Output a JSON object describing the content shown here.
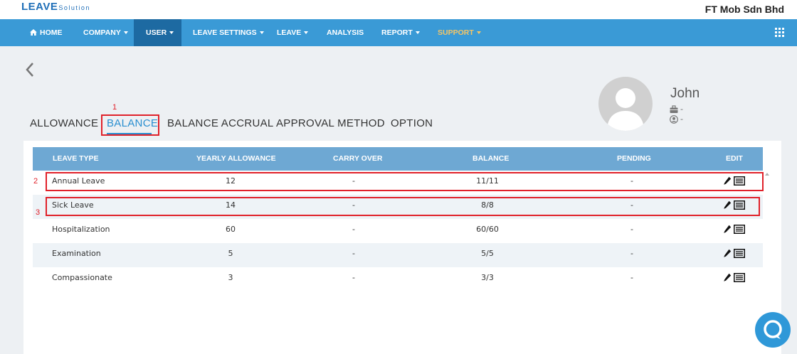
{
  "brand": {
    "logo_main": "LEAVE",
    "logo_sub": "Solution",
    "company": "FT Mob Sdn Bhd",
    "accent": "#3a9ad6"
  },
  "nav": {
    "items": [
      {
        "label": "HOME",
        "icon": "home-icon",
        "dropdown": false
      },
      {
        "label": "COMPANY",
        "dropdown": true
      },
      {
        "label": "USER",
        "dropdown": true,
        "active": true
      },
      {
        "label": "LEAVE SETTINGS",
        "dropdown": true
      },
      {
        "label": "LEAVE",
        "dropdown": true
      },
      {
        "label": "ANALYSIS",
        "dropdown": false
      },
      {
        "label": "REPORT",
        "dropdown": true
      },
      {
        "label": "SUPPORT",
        "dropdown": true,
        "highlight": "#f3c567"
      }
    ],
    "apps_icon": "grid-icon"
  },
  "profile": {
    "name": "John",
    "department": "-",
    "role": "-"
  },
  "tabs": [
    {
      "label": "ALLOWANCE"
    },
    {
      "label": "BALANCE",
      "active": true
    },
    {
      "label": "BALANCE ACCRUAL"
    },
    {
      "label": "APPROVAL METHOD"
    },
    {
      "label": "OPTION"
    }
  ],
  "annotations": [
    "1",
    "2",
    "3"
  ],
  "table": {
    "columns": [
      "LEAVE TYPE",
      "YEARLY ALLOWANCE",
      "CARRY OVER",
      "BALANCE",
      "PENDING",
      "EDIT"
    ],
    "rows": [
      {
        "type": "Annual Leave",
        "yearly": "12",
        "carry": "-",
        "balance": "11/11",
        "pending": "-"
      },
      {
        "type": "Sick Leave",
        "yearly": "14",
        "carry": "-",
        "balance": "8/8",
        "pending": "-"
      },
      {
        "type": "Hospitalization",
        "yearly": "60",
        "carry": "-",
        "balance": "60/60",
        "pending": "-"
      },
      {
        "type": "Examination",
        "yearly": "5",
        "carry": "-",
        "balance": "5/5",
        "pending": "-"
      },
      {
        "type": "Compassionate",
        "yearly": "3",
        "carry": "-",
        "balance": "3/3",
        "pending": "-"
      }
    ]
  },
  "colors": {
    "nav_bg": "#3a9ad6",
    "nav_active": "#1d6aa2",
    "table_header": "#6ea8d3",
    "annotation": "#e0212a",
    "tab_active": "#2a8fd0"
  }
}
